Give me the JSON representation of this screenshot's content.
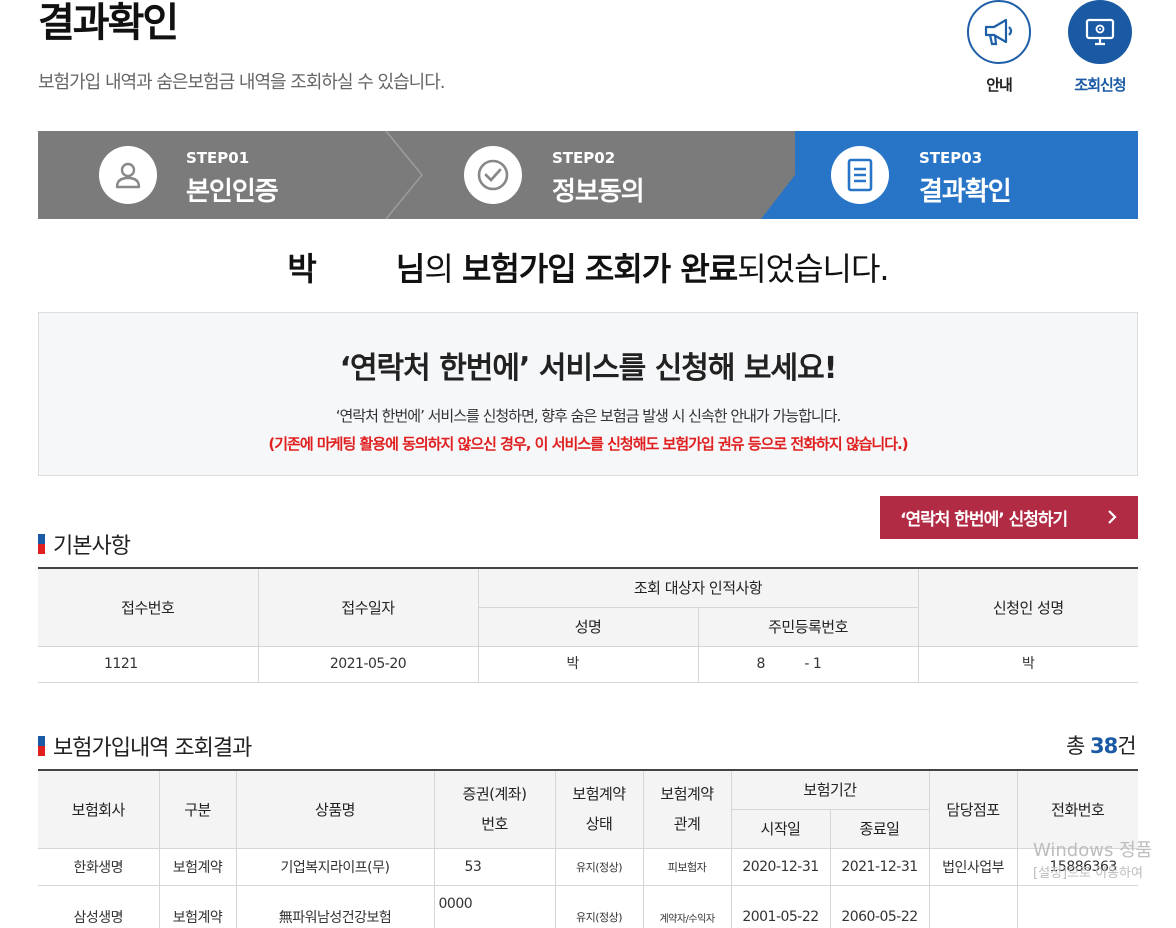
{
  "header": {
    "title": "결과확인",
    "subtitle": "보험가입 내역과 숨은보험금 내역을 조회하실 수 있습니다.",
    "btn_guide": "안내",
    "btn_request": "조회신청"
  },
  "steps": [
    {
      "num": "STEP01",
      "name": "본인인증"
    },
    {
      "num": "STEP02",
      "name": "정보동의"
    },
    {
      "num": "STEP03",
      "name": "결과확인"
    }
  ],
  "complete": {
    "name": "박",
    "honor": "님",
    "particle": "의",
    "bold1": "보험가입",
    "bold2": "조회가 완료",
    "rest": "되었습니다."
  },
  "promo": {
    "heading": "‘연락처 한번에’ 서비스를 신청해 보세요!",
    "desc": "‘연락처 한번에’ 서비스를 신청하면, 향후 숨은 보험금 발생 시 신속한 안내가 가능합니다.",
    "warning": "(기존에 마케팅 활용에 동의하지 않으신 경우, 이 서비스를 신청해도 보험가입 권유 등으로 전화하지 않습니다.)",
    "apply_label": "‘연락처 한번에’ 신청하기"
  },
  "basic": {
    "section_title": "기본사항",
    "headers": {
      "receipt_no": "접수번호",
      "receipt_date": "접수일자",
      "target": "조회 대상자 인적사항",
      "name": "성명",
      "rrn": "주민등록번호",
      "applicant": "신청인 성명"
    },
    "row": {
      "receipt_no": "1121",
      "receipt_date": "2021-05-20",
      "name": "박",
      "rrn": "8          - 1",
      "applicant": "박"
    }
  },
  "results": {
    "section_title": "보험가입내역 조회결과",
    "total_prefix": "총",
    "total_count": "38",
    "total_suffix": "건",
    "headers": {
      "company": "보험회사",
      "type": "구분",
      "product": "상품명",
      "cert1": "증권(계좌)",
      "cert2": "번호",
      "status1": "보험계약",
      "status2": "상태",
      "relation1": "보험계약",
      "relation2": "관계",
      "period": "보험기간",
      "start": "시작일",
      "end": "종료일",
      "branch": "담당점포",
      "phone": "전화번호"
    },
    "rows": [
      {
        "company": "한화생명",
        "type": "보험계약",
        "product": "기업복지라이프(무)",
        "cert": "53",
        "status": "유지(정상)",
        "relation": "피보험자",
        "start": "2020-12-31",
        "end": "2021-12-31",
        "branch": "법인사업부",
        "phone": "15886363"
      },
      {
        "company": "삼성생명",
        "type": "보험계약",
        "product": "無파워남성건강보험",
        "cert": "0000",
        "status": "유지(정상)",
        "relation": "계약자/수익자",
        "start": "2001-05-22",
        "end": "2060-05-22",
        "branch": "",
        "phone": ""
      }
    ]
  },
  "watermark": {
    "line1": "Windows 정품",
    "line2": "[설정]으로 이동하여"
  }
}
